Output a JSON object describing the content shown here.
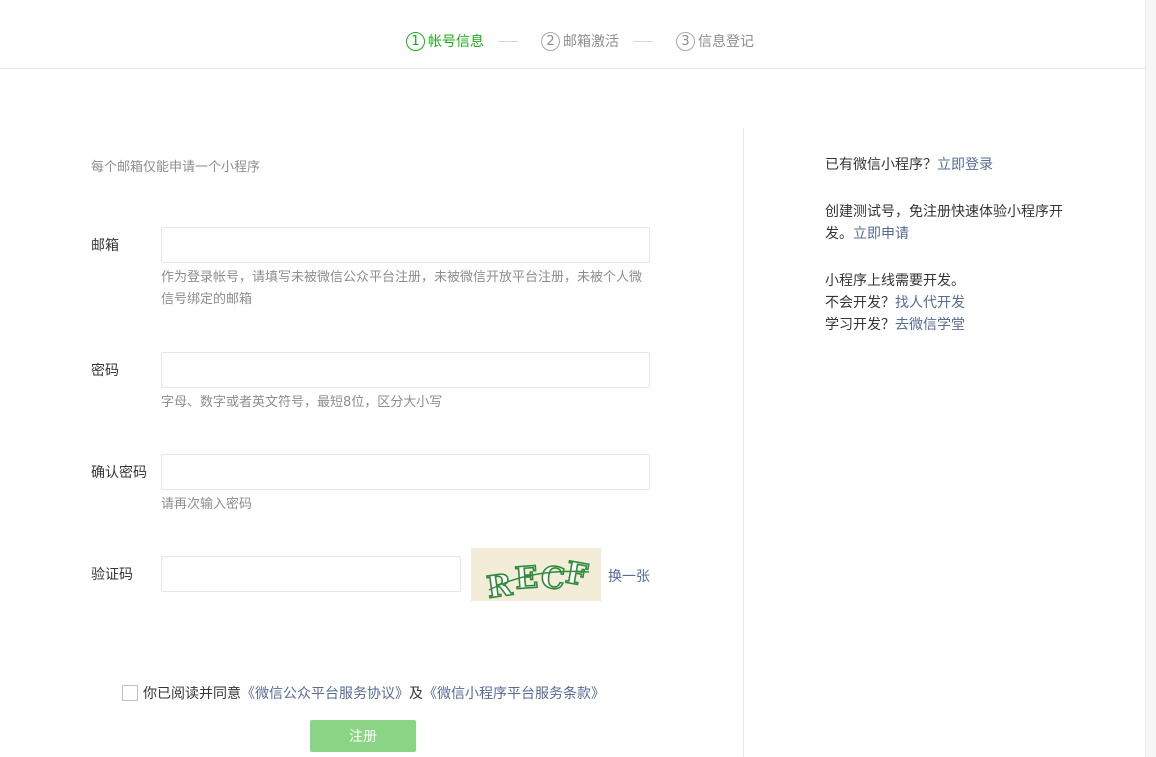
{
  "steps": [
    {
      "num": "1",
      "label": "帐号信息",
      "active": true
    },
    {
      "num": "2",
      "label": "邮箱激活",
      "active": false
    },
    {
      "num": "3",
      "label": "信息登记",
      "active": false
    }
  ],
  "form": {
    "intro": "每个邮箱仅能申请一个小程序",
    "email": {
      "label": "邮箱",
      "value": "",
      "tip": "作为登录帐号，请填写未被微信公众平台注册，未被微信开放平台注册，未被个人微信号绑定的邮箱"
    },
    "password": {
      "label": "密码",
      "value": "",
      "tip": "字母、数字或者英文符号，最短8位，区分大小写"
    },
    "confirm": {
      "label": "确认密码",
      "value": "",
      "tip": "请再次输入密码"
    },
    "captcha": {
      "label": "验证码",
      "value": "",
      "image_text": "RECF",
      "refresh": "换一张"
    },
    "agreement": {
      "prefix": "你已阅读并同意",
      "link1": "《微信公众平台服务协议》",
      "mid": "及",
      "link2": "《微信小程序平台服务条款》",
      "checked": false
    },
    "submit_label": "注册"
  },
  "side": {
    "login_q": "已有微信小程序？",
    "login_link": "立即登录",
    "test_text": "创建测试号，免注册快速体验小程序开发。",
    "test_link": "立即申请",
    "dev_text": "小程序上线需要开发。",
    "dev_q1": "不会开发？",
    "dev_link1": "找人代开发",
    "dev_q2": "学习开发？",
    "dev_link2": "去微信学堂"
  },
  "colors": {
    "accent": "#1aad19",
    "link": "#576b95",
    "button_disabled": "#8bd486"
  }
}
